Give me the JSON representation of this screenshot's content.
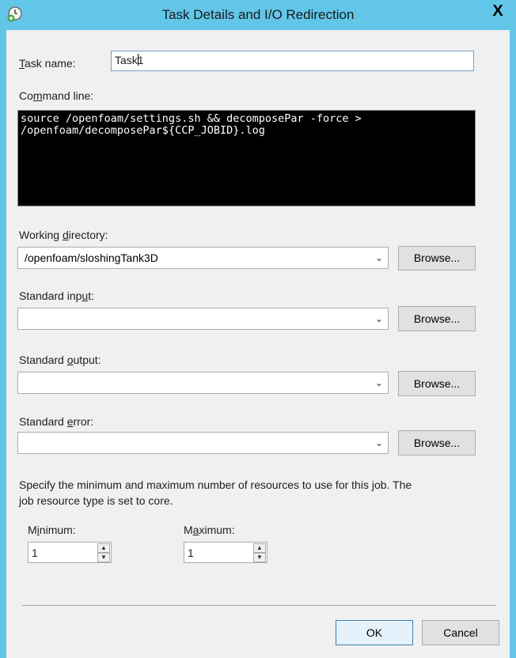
{
  "window": {
    "title": "Task Details and I/O Redirection",
    "close_label": "X"
  },
  "task_name": {
    "label_pre": "",
    "label_ul": "T",
    "label_post": "ask name:",
    "value_before_caret": "Task",
    "value_after_caret": "1"
  },
  "command_line": {
    "label_pre": "Co",
    "label_ul": "m",
    "label_post": "mand line:",
    "value": "source /openfoam/settings.sh && decomposePar -force >\n/openfoam/decomposePar${CCP_JOBID}.log"
  },
  "working_directory": {
    "label_pre": "Working ",
    "label_ul": "d",
    "label_post": "irectory:",
    "value": "/openfoam/sloshingTank3D",
    "browse_label": "Browse..."
  },
  "standard_input": {
    "label_pre": "Standard inp",
    "label_ul": "u",
    "label_post": "t:",
    "value": "",
    "browse_label": "Browse..."
  },
  "standard_output": {
    "label_pre": "Standard ",
    "label_ul": "o",
    "label_post": "utput:",
    "value": "",
    "browse_label": "Browse..."
  },
  "standard_error": {
    "label_pre": "Standard ",
    "label_ul": "e",
    "label_post": "rror:",
    "value": "",
    "browse_label": "Browse..."
  },
  "resources": {
    "description_line1": "Specify the minimum and maximum number of resources to use for this job. The",
    "description_line2": "job resource type is set to core.",
    "minimum": {
      "label_pre": "M",
      "label_ul": "i",
      "label_post": "nimum:",
      "value": "1"
    },
    "maximum": {
      "label_pre": "M",
      "label_ul": "a",
      "label_post": "ximum:",
      "value": "1"
    }
  },
  "buttons": {
    "ok_label": "OK",
    "cancel_label": "Cancel"
  },
  "icons": {
    "app": "task-clock-add-icon",
    "dropdown": "chevron-down-icon",
    "spin_up": "spin-up-icon",
    "spin_down": "spin-down-icon"
  },
  "colors": {
    "titlebar": "#62c6e9",
    "client": "#f0f0f0",
    "command_bg": "#000000"
  }
}
